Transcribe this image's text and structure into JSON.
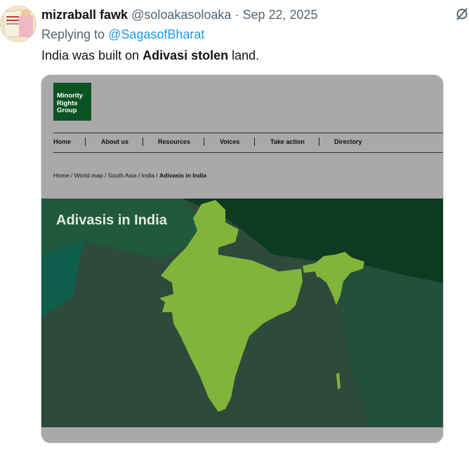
{
  "tweet": {
    "display_name": "mizraball fawk",
    "handle": "@soloakasoloaka",
    "separator": "·",
    "date": "Sep 22, 2025",
    "replying_prefix": "Replying to ",
    "replying_handle": "@SagasofBharat",
    "text_part1": "India was built on ",
    "text_bold": "Adivasi stolen",
    "text_part2": " land.",
    "avatar_icon": "avatar-image",
    "grok_icon": "grok-icon"
  },
  "media": {
    "logo_lines": [
      "Minority",
      "Rights",
      "Group"
    ],
    "nav": [
      "Home",
      "About us",
      "Resources",
      "Voices",
      "Take action",
      "Directory"
    ],
    "breadcrumb": {
      "trail": "Home / World map / South Asia / India / ",
      "current": "Adivasis in India"
    },
    "map_title": "Adivasis in India",
    "colors": {
      "india": "#82b43a",
      "sea": "#2d4a3b",
      "neighbors_dark": "#0e3a22",
      "logo": "#0b5323"
    }
  }
}
